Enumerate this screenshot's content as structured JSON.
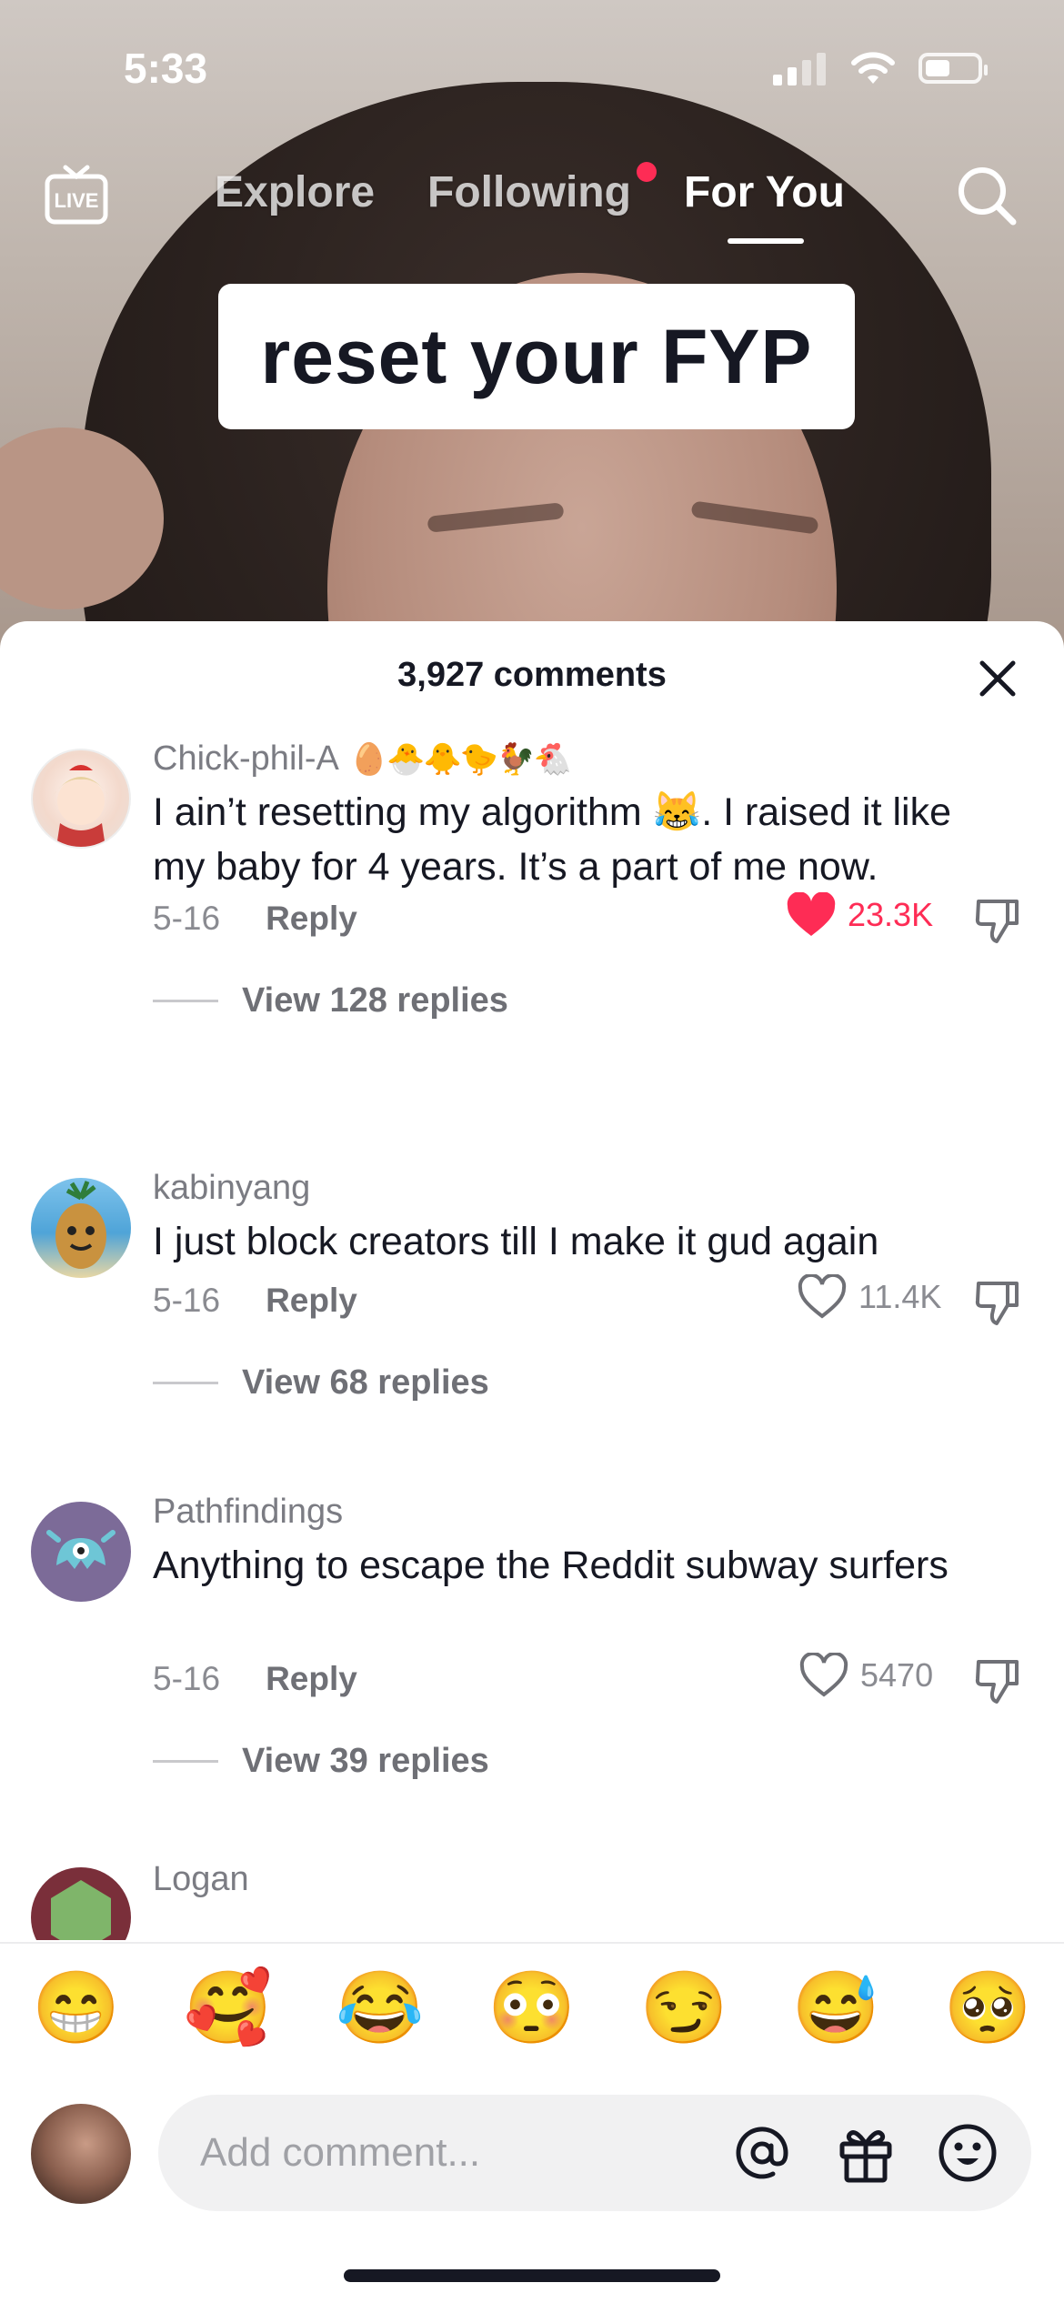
{
  "status_bar": {
    "time": "5:33"
  },
  "top_nav": {
    "live_label": "LIVE",
    "tabs": [
      {
        "label": "Explore",
        "active": false
      },
      {
        "label": "Following",
        "active": false,
        "has_notification_dot": true
      },
      {
        "label": "For You",
        "active": true
      }
    ]
  },
  "video": {
    "caption": "reset your FYP"
  },
  "comments_sheet": {
    "title": "3,927 comments",
    "comments": [
      {
        "username": "Chick-phil-A",
        "username_emojis": "🥚🐣🐥🐤🐓🐔",
        "text": "I ain’t resetting my algorithm 😹. I raised it like my baby for 4 years. It’s a part of me now.",
        "date": "5-16",
        "reply_label": "Reply",
        "likes": "23.3K",
        "liked": true,
        "view_replies": "View 128 replies"
      },
      {
        "username": "kabinyang",
        "text": "I just block creators till I make it gud again",
        "date": "5-16",
        "reply_label": "Reply",
        "likes": "11.4K",
        "liked": false,
        "view_replies": "View 68 replies"
      },
      {
        "username": "Pathfindings",
        "text": "Anything to escape the Reddit subway surfers",
        "date": "5-16",
        "reply_label": "Reply",
        "likes": "5470",
        "liked": false,
        "view_replies": "View 39 replies"
      },
      {
        "username": "Logan"
      }
    ]
  },
  "emoji_bar": [
    "😁",
    "🥰",
    "😂",
    "😳",
    "😏",
    "😅",
    "🥺"
  ],
  "composer": {
    "placeholder": "Add comment..."
  },
  "colors": {
    "accent": "#fe2c55",
    "text": "#161823",
    "muted": "#8a8b91"
  }
}
